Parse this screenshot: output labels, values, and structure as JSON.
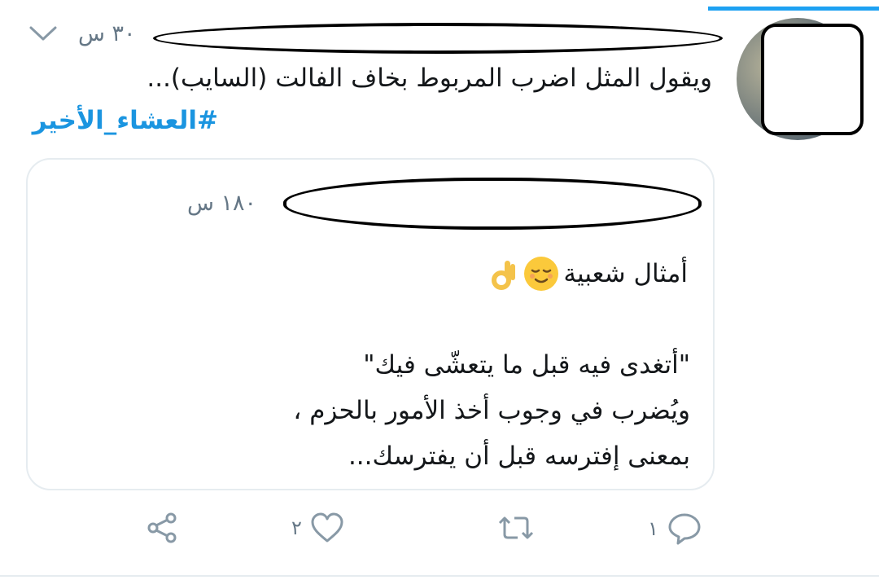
{
  "tweet": {
    "time": "٣٠ س",
    "text": "ويقول المثل اضرب المربوط بخاف الفالت (السايب)...",
    "hashtag": "#العشاء_الأخير"
  },
  "quoted_tweet": {
    "time": "١٨٠ س",
    "title": "أمثال شعبية",
    "body": "\"أتغدى فيه قبل ما يتعشّى فيك\"\nويُضرب في وجوب أخذ الأمور بالحزم ،\nبمعنى إفترسه قبل أن يفترسك..."
  },
  "actions": {
    "reply_count": "١",
    "retweet_count": "",
    "like_count": "٢"
  },
  "icons": {
    "caret": "chevron-down-icon",
    "reply": "reply-icon",
    "retweet": "retweet-icon",
    "like": "heart-icon",
    "share": "share-icon"
  },
  "colors": {
    "accent": "#1da1f2",
    "hashtag": "#1b95e0",
    "muted": "#657786"
  }
}
